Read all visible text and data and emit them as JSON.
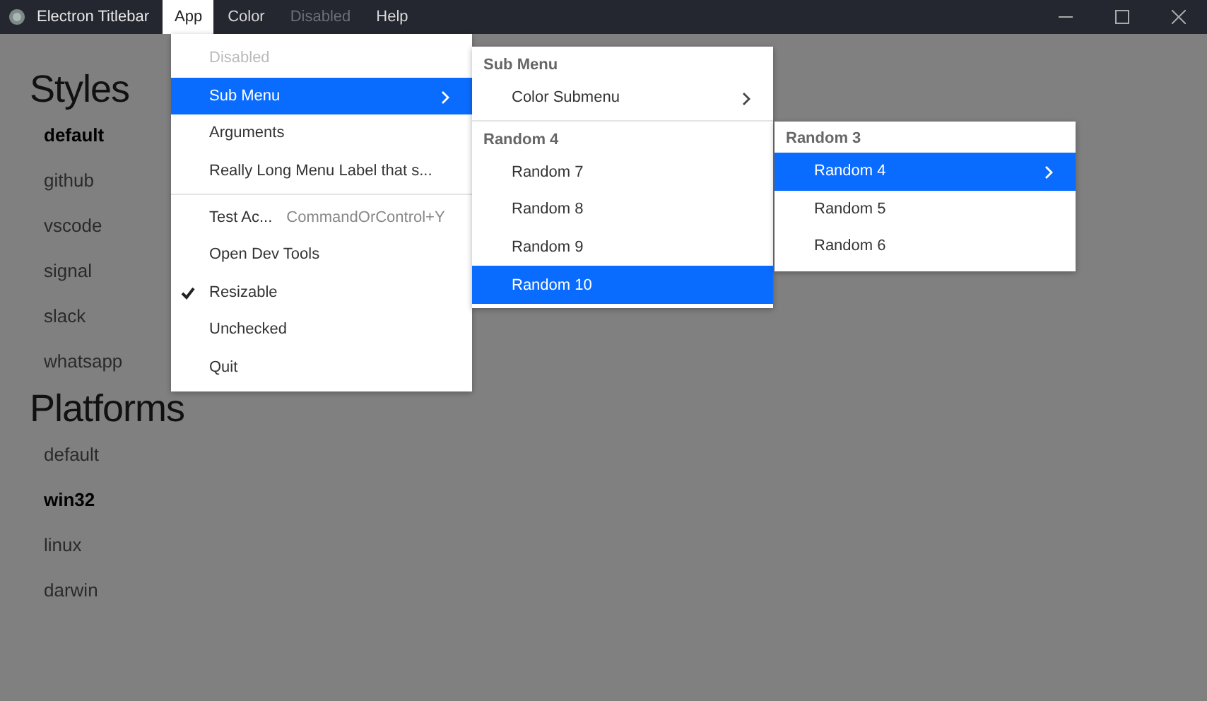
{
  "titlebar": {
    "title": "Electron Titlebar",
    "menus": [
      {
        "label": "App",
        "selected": true,
        "disabled": false
      },
      {
        "label": "Color",
        "selected": false,
        "disabled": false
      },
      {
        "label": "Disabled",
        "selected": false,
        "disabled": true
      },
      {
        "label": "Help",
        "selected": false,
        "disabled": false
      }
    ]
  },
  "sections": [
    {
      "title": "Styles",
      "items": [
        {
          "label": "default",
          "selected": true
        },
        {
          "label": "github",
          "selected": false
        },
        {
          "label": "vscode",
          "selected": false
        },
        {
          "label": "signal",
          "selected": false
        },
        {
          "label": "slack",
          "selected": false
        },
        {
          "label": "whatsapp",
          "selected": false
        }
      ]
    },
    {
      "title": "Platforms",
      "items": [
        {
          "label": "default",
          "selected": false
        },
        {
          "label": "win32",
          "selected": true
        },
        {
          "label": "linux",
          "selected": false
        },
        {
          "label": "darwin",
          "selected": false
        }
      ]
    }
  ],
  "menus": [
    {
      "items": [
        {
          "kind": "item",
          "label": "Disabled",
          "disabled": true,
          "selected": false,
          "checked": false,
          "submenu": false
        },
        {
          "kind": "item",
          "label": "Sub Menu",
          "disabled": false,
          "selected": true,
          "checked": false,
          "submenu": true
        },
        {
          "kind": "item",
          "label": "Arguments",
          "disabled": false,
          "selected": false,
          "checked": false,
          "submenu": false
        },
        {
          "kind": "item",
          "label": "Really Long Menu Label that s...",
          "disabled": false,
          "selected": false,
          "checked": false,
          "submenu": false
        },
        {
          "kind": "separator"
        },
        {
          "kind": "item",
          "label": "Test Ac...",
          "accelerator": "CommandOrControl+Y",
          "disabled": false,
          "selected": false,
          "checked": false,
          "submenu": false
        },
        {
          "kind": "item",
          "label": "Open Dev Tools",
          "disabled": false,
          "selected": false,
          "checked": false,
          "submenu": false
        },
        {
          "kind": "item",
          "label": "Resizable",
          "disabled": false,
          "selected": false,
          "checked": true,
          "submenu": false
        },
        {
          "kind": "item",
          "label": "Unchecked",
          "disabled": false,
          "selected": false,
          "checked": false,
          "submenu": false
        },
        {
          "kind": "item",
          "label": "Quit",
          "disabled": false,
          "selected": false,
          "checked": false,
          "submenu": false
        }
      ]
    },
    {
      "items": [
        {
          "kind": "header",
          "label": "Sub Menu"
        },
        {
          "kind": "item",
          "label": "Color Submenu",
          "disabled": false,
          "selected": false,
          "checked": false,
          "submenu": true
        },
        {
          "kind": "separator"
        },
        {
          "kind": "header",
          "label": "Random 4"
        },
        {
          "kind": "item",
          "label": "Random 7",
          "disabled": false,
          "selected": false,
          "checked": false,
          "submenu": false
        },
        {
          "kind": "item",
          "label": "Random 8",
          "disabled": false,
          "selected": false,
          "checked": false,
          "submenu": false
        },
        {
          "kind": "item",
          "label": "Random 9",
          "disabled": false,
          "selected": false,
          "checked": false,
          "submenu": false
        },
        {
          "kind": "item",
          "label": "Random 10",
          "disabled": false,
          "selected": true,
          "checked": false,
          "submenu": false
        }
      ]
    },
    {
      "items": [
        {
          "kind": "header",
          "label": "Random 3"
        },
        {
          "kind": "item",
          "label": "Random 4",
          "disabled": false,
          "selected": true,
          "checked": false,
          "submenu": true
        },
        {
          "kind": "item",
          "label": "Random 5",
          "disabled": false,
          "selected": false,
          "checked": false,
          "submenu": false
        },
        {
          "kind": "item",
          "label": "Random 6",
          "disabled": false,
          "selected": false,
          "checked": false,
          "submenu": false
        }
      ]
    }
  ]
}
